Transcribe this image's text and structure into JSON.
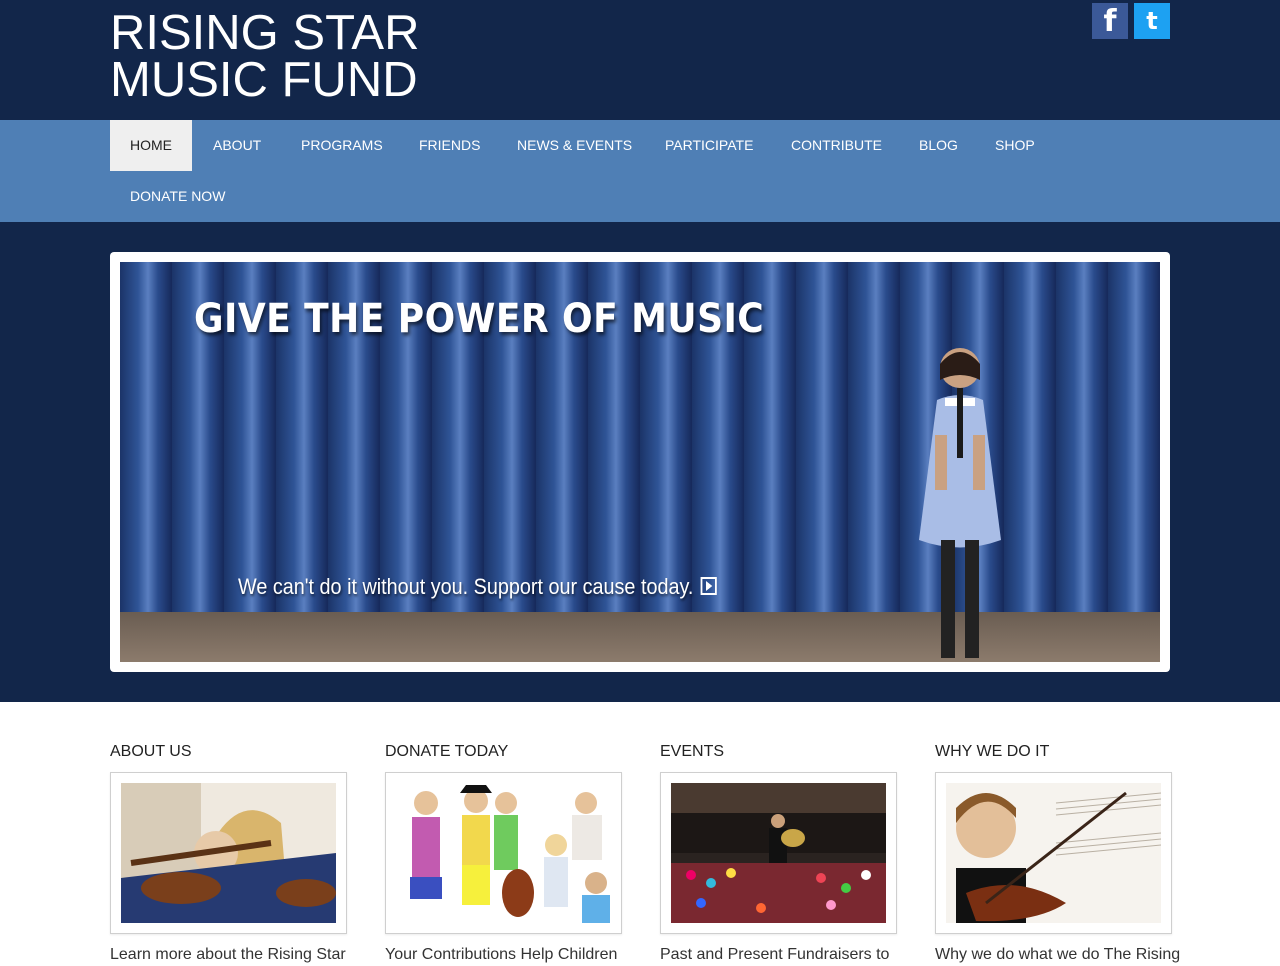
{
  "site": {
    "title_line1": "RISING STAR",
    "title_line2": "MUSIC FUND"
  },
  "social": {
    "facebook": "f",
    "twitter": "t"
  },
  "nav": {
    "items": [
      "HOME",
      "ABOUT",
      "PROGRAMS",
      "FRIENDS",
      "NEWS & EVENTS",
      "PARTICIPATE",
      "CONTRIBUTE",
      "BLOG",
      "SHOP"
    ],
    "donate": "DONATE NOW",
    "active": "HOME"
  },
  "hero": {
    "headline": "GIVE THE POWER OF MUSIC",
    "cta": "We can't do it without you. Support our cause today."
  },
  "cards": [
    {
      "title": "ABOUT US",
      "text": "Learn more about the Rising Star"
    },
    {
      "title": "DONATE TODAY",
      "text": "Your Contributions Help Children"
    },
    {
      "title": "EVENTS",
      "text": "Past and Present Fundraisers to"
    },
    {
      "title": "WHY WE DO IT",
      "text": "Why we do what we do The Rising"
    }
  ],
  "colors": {
    "header": "#12264a",
    "nav": "#4f7fb5",
    "active_nav": "#efefef"
  }
}
